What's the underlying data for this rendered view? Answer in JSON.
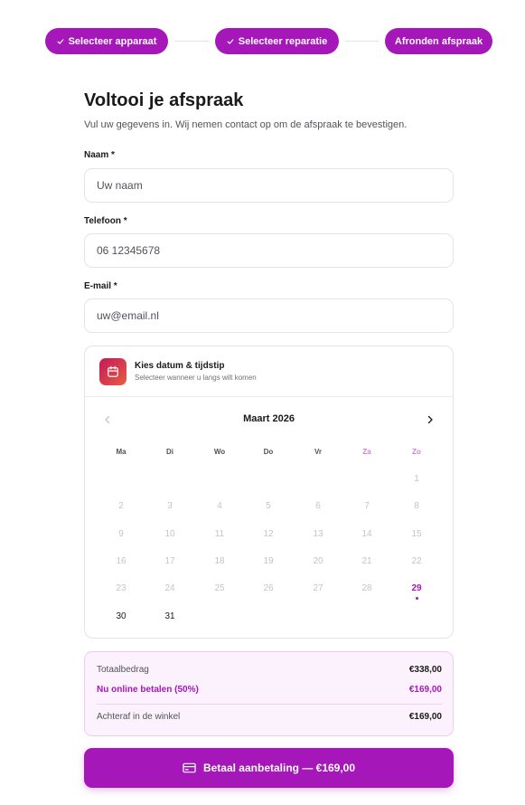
{
  "stepper": {
    "steps": [
      {
        "label": "Selecteer apparaat",
        "completed": true
      },
      {
        "label": "Selecteer reparatie",
        "completed": true
      },
      {
        "label": "Afronden afspraak",
        "completed": false
      }
    ]
  },
  "header": {
    "title": "Voltooi je afspraak",
    "subtitle": "Vul uw gegevens in. Wij nemen contact op om de afspraak te bevestigen."
  },
  "fields": {
    "name": {
      "label": "Naam *",
      "placeholder": "Uw naam",
      "value": ""
    },
    "phone": {
      "label": "Telefoon *",
      "placeholder": "06 12345678",
      "value": ""
    },
    "email": {
      "label": "E-mail *",
      "placeholder": "uw@email.nl",
      "value": ""
    }
  },
  "calendar": {
    "title": "Kies datum & tijdstip",
    "subtitle": "Selecteer wanneer u langs wilt komen",
    "month": "Maart 2026",
    "weekdays": [
      "Ma",
      "Di",
      "Wo",
      "Do",
      "Vr",
      "Za",
      "Zo"
    ],
    "days": [
      "1",
      "2",
      "3",
      "4",
      "5",
      "6",
      "7",
      "8",
      "9",
      "10",
      "11",
      "12",
      "13",
      "14",
      "15",
      "16",
      "17",
      "18",
      "19",
      "20",
      "21",
      "22",
      "23",
      "24",
      "25",
      "26",
      "27",
      "28",
      "29",
      "30",
      "31"
    ],
    "first_weekday_index": 6,
    "today": "29",
    "available": [
      "29",
      "30",
      "31"
    ],
    "icons": {
      "prev": "chevron-left-icon",
      "next": "chevron-right-icon",
      "header": "calendar-icon"
    }
  },
  "summary": {
    "total_label": "Totaalbedrag",
    "total_value": "€338,00",
    "online_label": "Nu online betalen (50%)",
    "online_value": "€169,00",
    "store_label": "Achteraf in de winkel",
    "store_value": "€169,00"
  },
  "pay_button": {
    "label": "Betaal aanbetaling — €169,00",
    "icon": "credit-card-icon"
  },
  "colors": {
    "accent": "#a517b8",
    "accent_light": "#fcf2fd",
    "weekend": "#d97ad9"
  }
}
